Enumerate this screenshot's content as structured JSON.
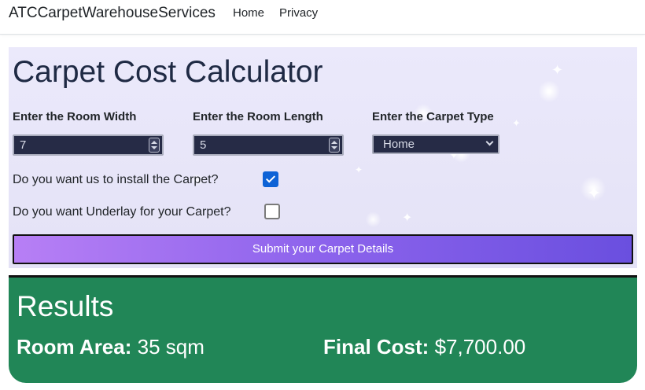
{
  "navbar": {
    "brand": "ATCCarpetWarehouseServices",
    "links": [
      "Home",
      "Privacy"
    ]
  },
  "calculator": {
    "title": "Carpet Cost Calculator",
    "width_label": "Enter the Room Width",
    "width_value": "7",
    "length_label": "Enter the Room Length",
    "length_value": "5",
    "type_label": "Enter the Carpet Type",
    "type_selected": "Home",
    "install_question": "Do you want us to install the Carpet?",
    "install_checked": true,
    "underlay_question": "Do you want Underlay for your Carpet?",
    "underlay_checked": false,
    "submit_label": "Submit your Carpet Details"
  },
  "results": {
    "title": "Results",
    "area_label": "Room Area:",
    "area_value": "35 sqm",
    "cost_label": "Final Cost:",
    "cost_value": "$7,700.00"
  },
  "colors": {
    "results_bg": "#218657",
    "button_gradient_start": "#b77ff5",
    "button_gradient_end": "#6a4fdf",
    "input_bg": "#262b46",
    "checkbox_checked": "#0d62d6"
  },
  "icons": {
    "spinner": "number-spinner-icon",
    "dropdown": "chevron-down-icon",
    "check": "checkmark-icon"
  }
}
